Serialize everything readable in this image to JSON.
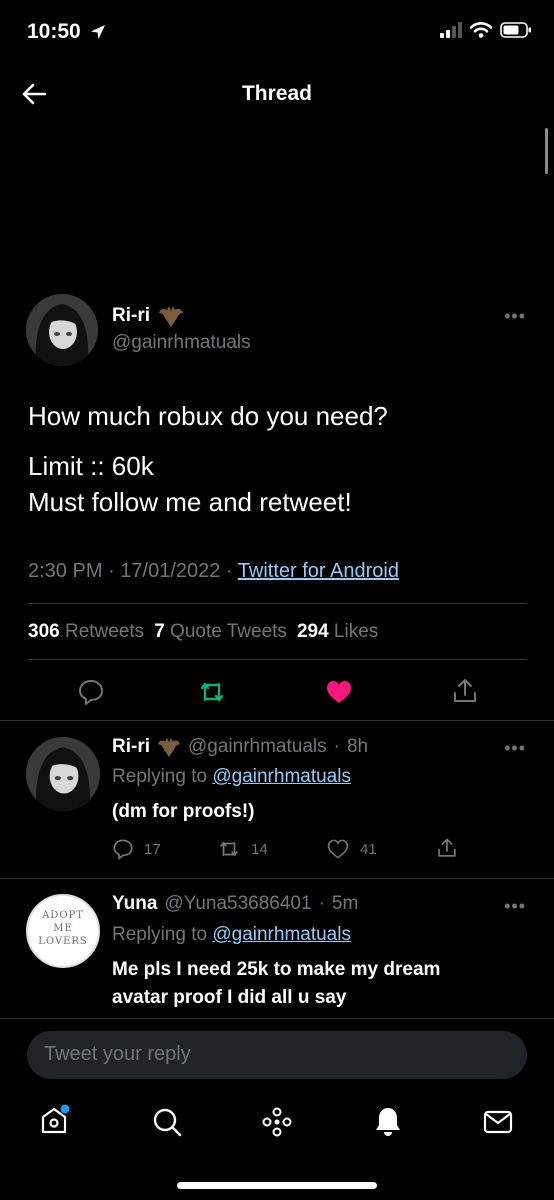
{
  "status_bar": {
    "time": "10:50"
  },
  "header": {
    "title": "Thread"
  },
  "main_tweet": {
    "name": "Ri-ri",
    "handle": "@gainrhmatuals",
    "text_line1": "How much robux do you need?",
    "text_line2": "Limit :: 60k",
    "text_line3": "Must follow me and retweet!",
    "time": "2:30 PM",
    "date": "17/01/2022",
    "source": "Twitter for Android",
    "retweets_count": "306",
    "retweets_label": "Retweets",
    "quotes_count": "7",
    "quotes_label": "Quote Tweets",
    "likes_count": "294",
    "likes_label": "Likes",
    "liked": true
  },
  "replies": [
    {
      "name": "Ri-ri",
      "handle": "@gainrhmatuals",
      "age": "8h",
      "replying_label": "Replying to",
      "replying_to": "@gainrhmatuals",
      "text": "(dm for proofs!)",
      "reply_count": "17",
      "retweet_count": "14",
      "like_count": "41"
    },
    {
      "name": "Yuna",
      "handle": "@Yuna53686401",
      "age": "5m",
      "replying_label": "Replying to",
      "replying_to": "@gainrhmatuals",
      "text_line1": "Me pls I need 25k to make my dream",
      "text_line2": "avatar proof I did all u say",
      "avatar_text": [
        "ADOPT",
        "ME",
        "LOVERS"
      ]
    }
  ],
  "compose": {
    "placeholder": "Tweet your reply"
  },
  "colors": {
    "accent": "#1d9bf0",
    "like": "#f91880",
    "retweet": "#00ba7c",
    "link": "#8ecdf8"
  }
}
